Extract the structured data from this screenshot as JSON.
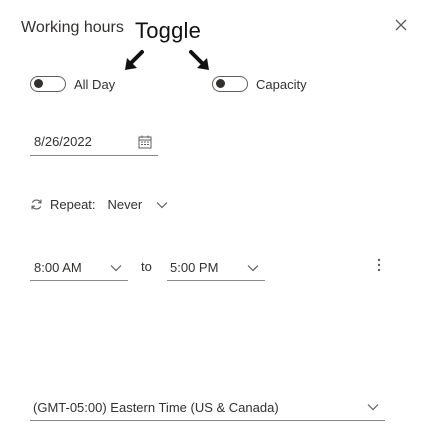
{
  "header": {
    "title": "Working hours",
    "annotation": "Toggle"
  },
  "toggles": {
    "all_day": {
      "label": "All Day",
      "on": false
    },
    "capacity": {
      "label": "Capacity",
      "on": false
    }
  },
  "date": {
    "value": "8/26/2022"
  },
  "repeat": {
    "label": "Repeat:",
    "value": "Never"
  },
  "time": {
    "start": "8:00 AM",
    "separator": "to",
    "end": "5:00 PM"
  },
  "timezone": {
    "value": "(GMT-05:00) Eastern Time (US & Canada)"
  },
  "icons": [
    "close-icon",
    "arrow-icon",
    "calendar-icon",
    "repeat-icon",
    "chevron-down-icon",
    "more-vertical-icon"
  ],
  "colors": {
    "text": "#323130",
    "border": "#8a8886",
    "icon": "#605e5c"
  }
}
